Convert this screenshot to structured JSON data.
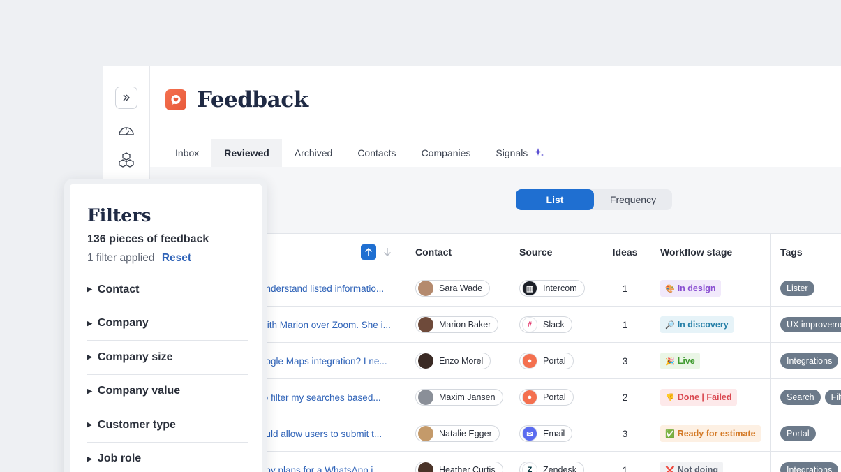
{
  "app": {
    "title": "Feedback"
  },
  "tabs": [
    {
      "label": "Inbox"
    },
    {
      "label": "Reviewed"
    },
    {
      "label": "Archived"
    },
    {
      "label": "Contacts"
    },
    {
      "label": "Companies"
    },
    {
      "label": "Signals"
    }
  ],
  "view_toggle": {
    "list": "List",
    "frequency": "Frequency"
  },
  "table": {
    "headers": {
      "contact": "Contact",
      "source": "Source",
      "ideas": "Ideas",
      "stage": "Workflow stage",
      "tags": "Tags"
    },
    "rows": [
      {
        "feedback": "understand listed informatio...",
        "contact": "Sara Wade",
        "source": "Intercom",
        "ideas": "1",
        "stage": "In design",
        "stage_icon": "🎨",
        "tags": [
          "Lister"
        ]
      },
      {
        "feedback": "with Marion over Zoom. She i...",
        "contact": "Marion Baker",
        "source": "Slack",
        "ideas": "1",
        "stage": "In discovery",
        "stage_icon": "🔎",
        "tags": [
          "UX improveme"
        ]
      },
      {
        "feedback": "oogle Maps integration? I ne...",
        "contact": "Enzo Morel",
        "source": "Portal",
        "ideas": "3",
        "stage": "Live",
        "stage_icon": "🎉",
        "tags": [
          "Integrations"
        ]
      },
      {
        "feedback": "to filter my searches based...",
        "contact": "Maxim Jansen",
        "source": "Portal",
        "ideas": "2",
        "stage": "Done | Failed",
        "stage_icon": "👎",
        "tags": [
          "Search",
          "Filte"
        ]
      },
      {
        "feedback": "ould allow users to submit t...",
        "contact": "Natalie Egger",
        "source": "Email",
        "ideas": "3",
        "stage": "Ready for estimate",
        "stage_icon": "✅",
        "tags": [
          "Portal"
        ]
      },
      {
        "feedback": "any plans for a WhatsApp i...",
        "contact": "Heather Curtis",
        "source": "Zendesk",
        "ideas": "1",
        "stage": "Not doing",
        "stage_icon": "❌",
        "tags": [
          "Integrations"
        ]
      }
    ]
  },
  "filters": {
    "title": "Filters",
    "count": "136 pieces of feedback",
    "applied": "1 filter applied",
    "reset": "Reset",
    "items": [
      "Contact",
      "Company",
      "Company size",
      "Company value",
      "Customer type",
      "Job role"
    ]
  },
  "colors": {
    "accent": "#1f6fd1",
    "brand": "#f4704f",
    "stage_design_bg": "#f1e9fb",
    "stage_design_fg": "#8a4fd1",
    "stage_discovery_bg": "#e6f3f8",
    "stage_discovery_fg": "#2680a8",
    "stage_live_bg": "#eaf6e6",
    "stage_live_fg": "#3e9a2e",
    "stage_failed_bg": "#fde9ea",
    "stage_failed_fg": "#d9474f",
    "stage_estimate_bg": "#fdf0e3",
    "stage_estimate_fg": "#d47a26",
    "stage_notdoing_bg": "#f1f2f4",
    "stage_notdoing_fg": "#5b6270"
  }
}
